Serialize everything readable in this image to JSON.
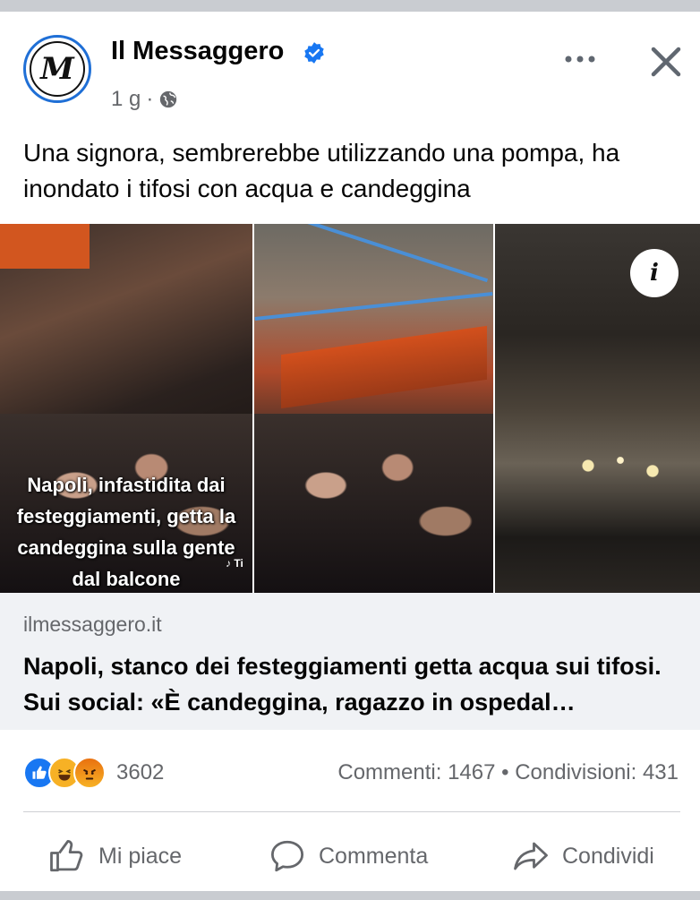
{
  "post": {
    "page_name": "Il Messaggero",
    "avatar_letter": "M",
    "time": "1 g",
    "separator": "·",
    "caption": "Una signora, sembrerebbe utilizzando una pompa, ha inondato i tifosi con acqua e candeggina"
  },
  "media": {
    "overlay_line1": "Napoli, infastidita dai",
    "overlay_line2": "festeggiamenti, getta la",
    "overlay_line3": "candeggina sulla gente",
    "overlay_line4": "dal balcone",
    "watermark": "♪ Ti",
    "info_label": "i"
  },
  "link": {
    "domain": "ilmessaggero.it",
    "title": "Napoli, stanco dei festeggiamenti getta acqua sui tifosi. Sui social: «È candeggina, ragazzo in ospedal…"
  },
  "stats": {
    "reactions_count": "3602",
    "comments": "Commenti: 1467",
    "bullet": "•",
    "shares": "Condivisioni: 431"
  },
  "actions": {
    "like": "Mi piace",
    "comment": "Commenta",
    "share": "Condividi"
  },
  "colors": {
    "brand_blue": "#1877f2",
    "text_secondary": "#65676b",
    "link_bg": "#f0f2f5"
  }
}
